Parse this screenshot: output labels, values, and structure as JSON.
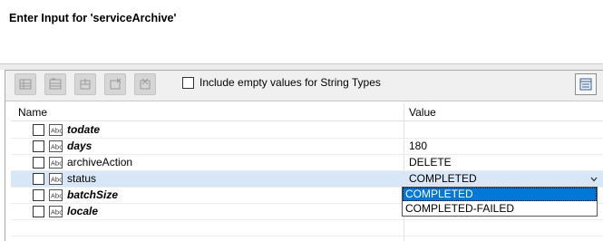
{
  "header": {
    "title": "Enter Input for 'serviceArchive'"
  },
  "toolbar": {
    "buttons": [
      "add-row-icon",
      "remove-row-icon",
      "move-up-icon",
      "move-down-icon",
      "clear-icon"
    ],
    "include_empty_label": "Include empty values for String Types",
    "include_empty_checked": false
  },
  "table": {
    "columns": {
      "name": "Name",
      "value": "Value"
    },
    "rows": [
      {
        "name": "todate",
        "value": "",
        "bold": true,
        "checked": false
      },
      {
        "name": "days",
        "value": "180",
        "bold": true,
        "checked": false
      },
      {
        "name": "archiveAction",
        "value": "DELETE",
        "bold": false,
        "checked": false
      },
      {
        "name": "status",
        "value": "COMPLETED",
        "bold": false,
        "checked": false
      },
      {
        "name": "batchSize",
        "value": "",
        "bold": true,
        "checked": false
      },
      {
        "name": "locale",
        "value": "",
        "bold": true,
        "checked": false
      }
    ]
  },
  "dropdown": {
    "options": [
      "COMPLETED",
      "COMPLETED-FAILED"
    ],
    "selected": "COMPLETED"
  },
  "colors": {
    "selection": "#d7e7f8",
    "highlight": "#0078d7"
  }
}
